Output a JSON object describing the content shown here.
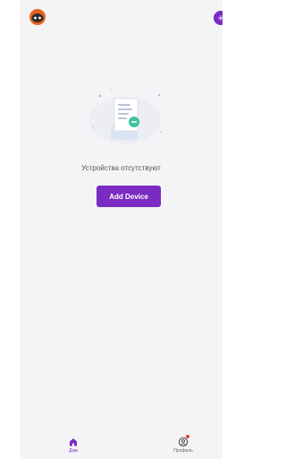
{
  "header": {
    "logo_icon": "robot-cat-logo-icon",
    "add_icon": "plus-icon"
  },
  "empty_state": {
    "illustration_icon": "document-minus-icon",
    "message": "Устройства отсутствуют",
    "add_device_label": "Add Device"
  },
  "tabs": [
    {
      "label": "Дом",
      "icon": "home-icon",
      "active": true
    },
    {
      "label": "Профиль",
      "icon": "profile-icon",
      "has_badge": true
    }
  ],
  "colors": {
    "accent": "#7a2bc2",
    "background": "#f4f4f6",
    "badge": "#e23b3b"
  }
}
